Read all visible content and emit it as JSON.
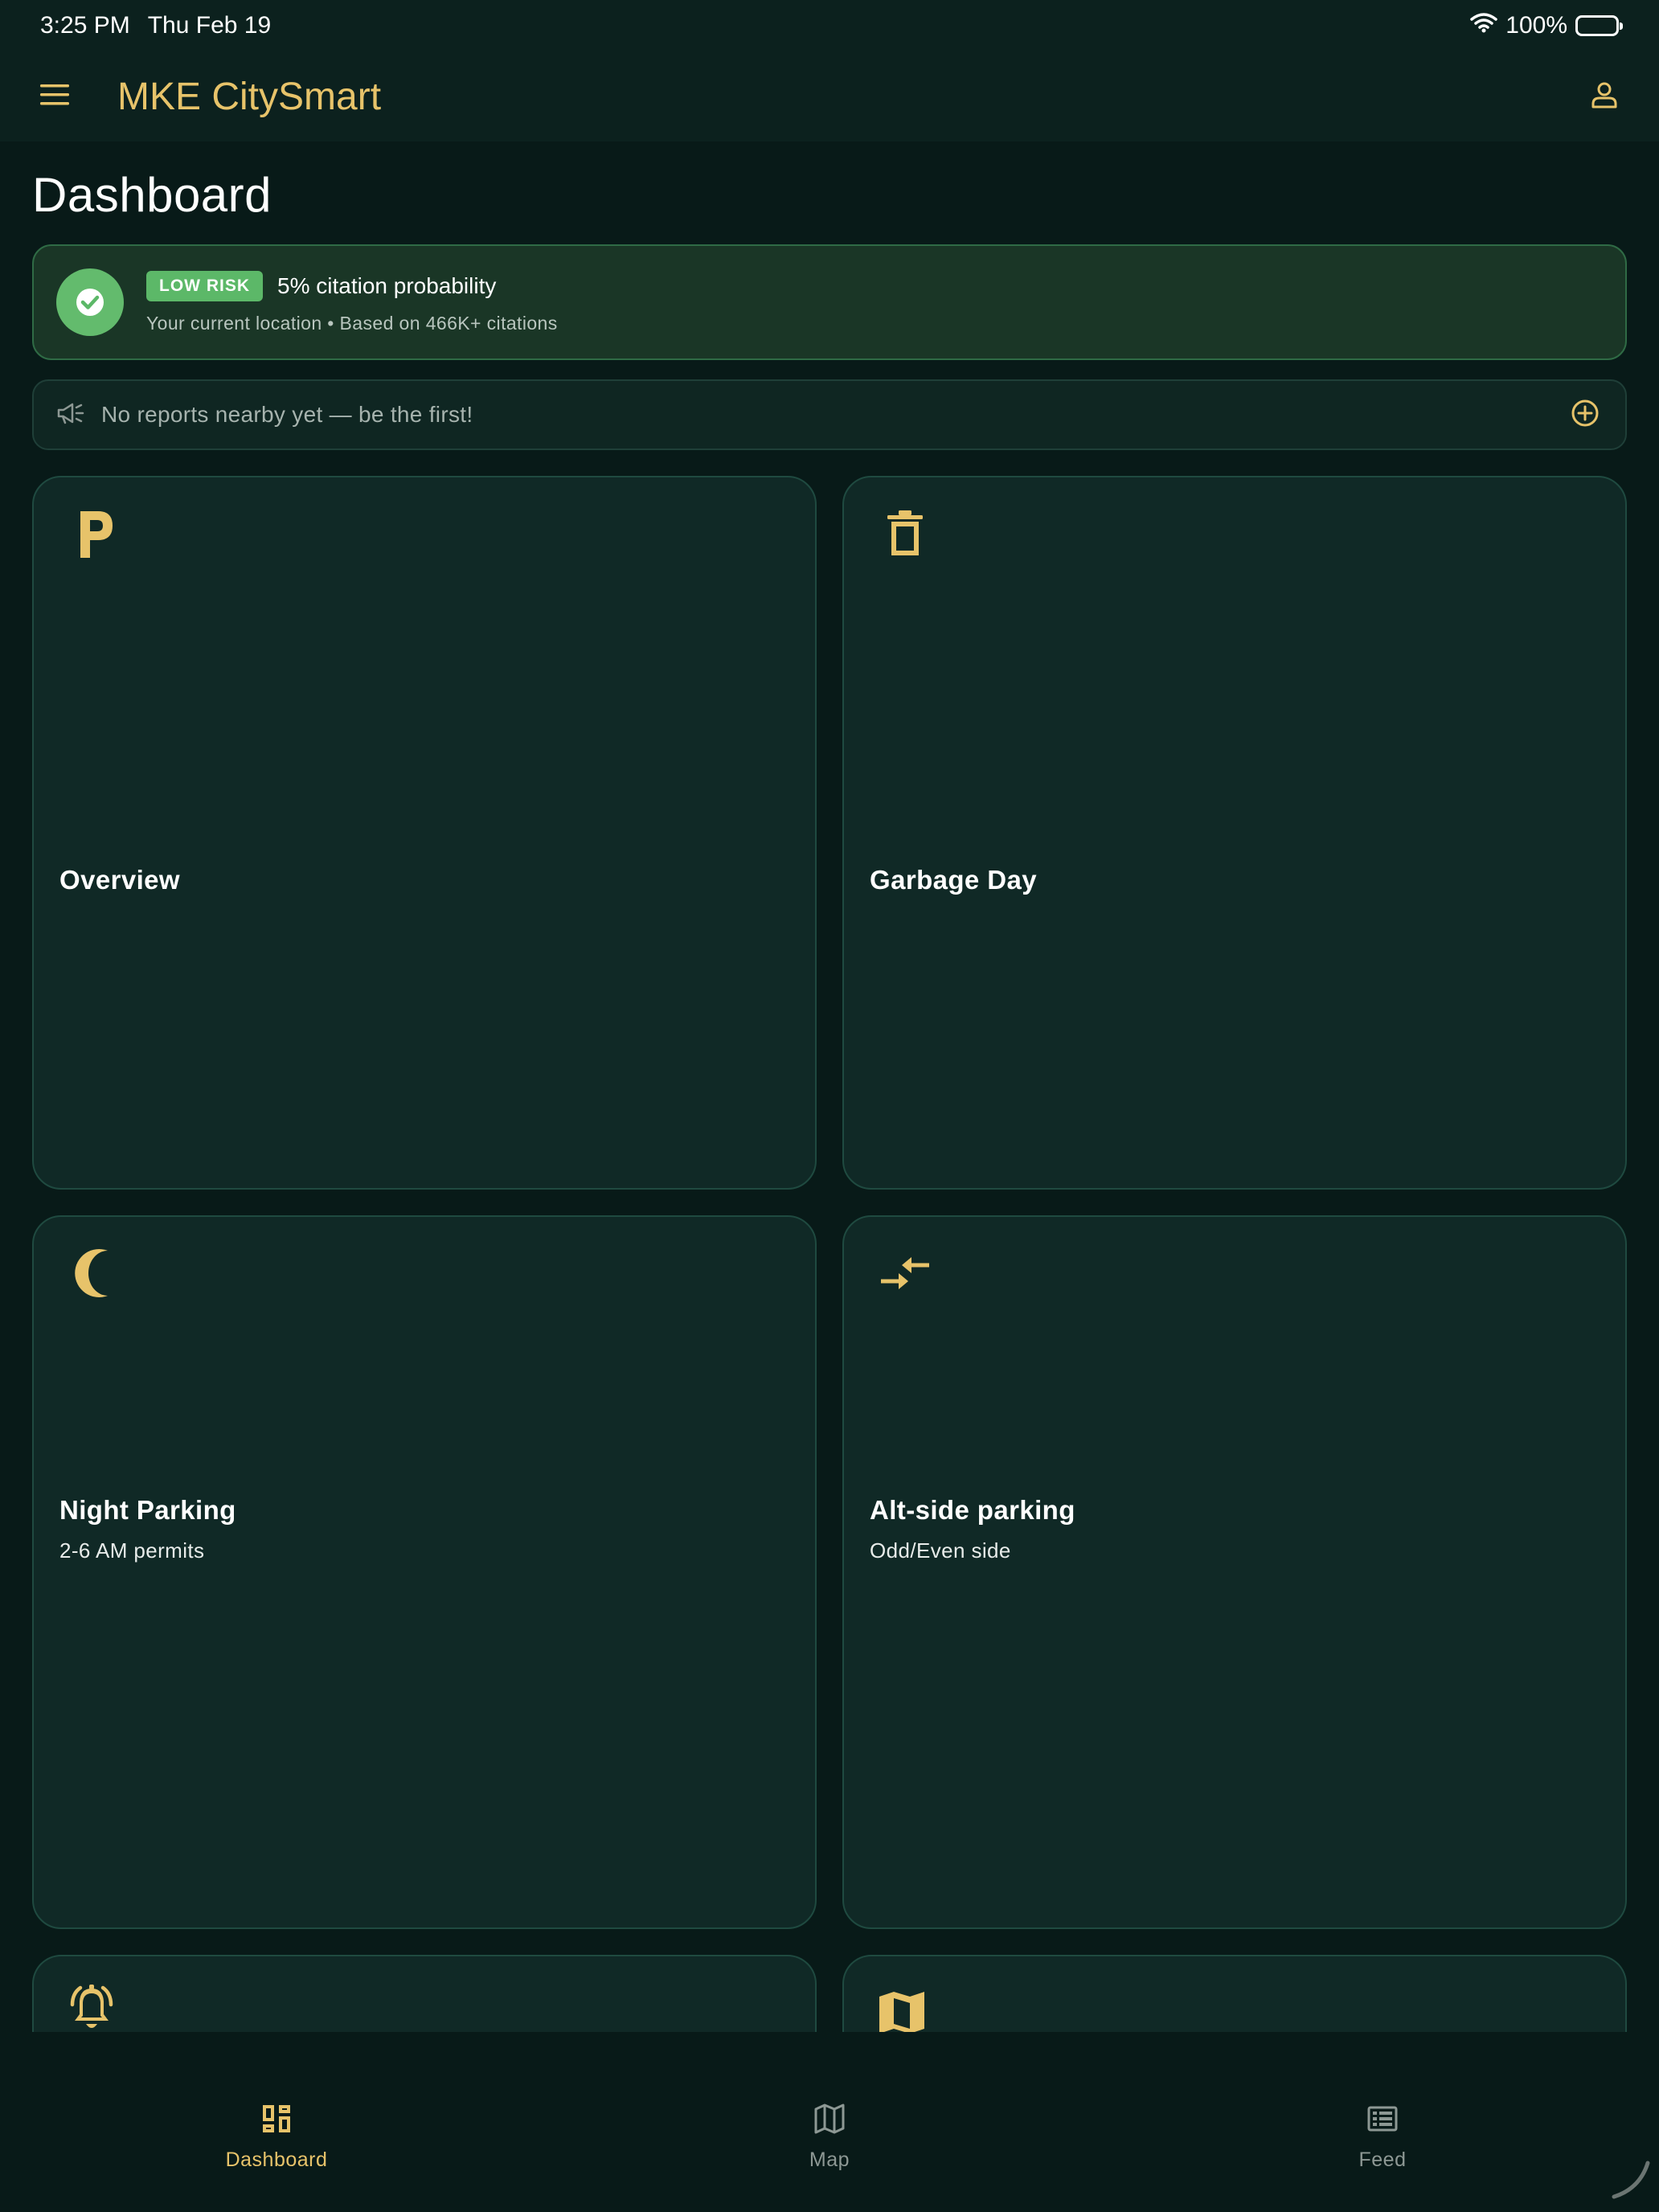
{
  "status_bar": {
    "time": "3:25 PM",
    "date": "Thu Feb 19",
    "battery": "100%",
    "wifi_icon": "wifi-icon",
    "battery_icon": "battery-icon"
  },
  "app_bar": {
    "title": "MKE CitySmart",
    "menu_icon": "menu-icon",
    "profile_icon": "profile-icon"
  },
  "page": {
    "title": "Dashboard"
  },
  "risk": {
    "badge": "LOW RISK",
    "probability_text": "5% citation probability",
    "subtitle": "Your current location • Based on 466K+ citations",
    "icon": "check-circle-icon"
  },
  "reports": {
    "text": "No reports nearby yet — be the first!",
    "icon": "megaphone-icon",
    "action_icon": "add-circle-icon"
  },
  "cards": [
    {
      "title": "Overview",
      "subtitle": "",
      "icon": "parking-icon"
    },
    {
      "title": "Garbage Day",
      "subtitle": "",
      "icon": "trash-icon"
    },
    {
      "title": "Night Parking",
      "subtitle": "2-6 AM permits",
      "icon": "moon-icon"
    },
    {
      "title": "Alt-side parking",
      "subtitle": "Odd/Even side",
      "icon": "swap-arrows-icon"
    },
    {
      "title": "",
      "subtitle": "",
      "icon": "bell-ringing-icon"
    },
    {
      "title": "",
      "subtitle": "",
      "icon": "map-icon"
    }
  ],
  "bottom_nav": {
    "items": [
      {
        "label": "Dashboard",
        "icon": "dashboard-icon",
        "active": true
      },
      {
        "label": "Map",
        "icon": "map-outline-icon",
        "active": false
      },
      {
        "label": "Feed",
        "icon": "feed-icon",
        "active": false
      }
    ]
  },
  "colors": {
    "background": "#081a18",
    "surface": "#102926",
    "accent": "#e7c36a",
    "success": "#5cb868",
    "muted": "#8d9894"
  }
}
